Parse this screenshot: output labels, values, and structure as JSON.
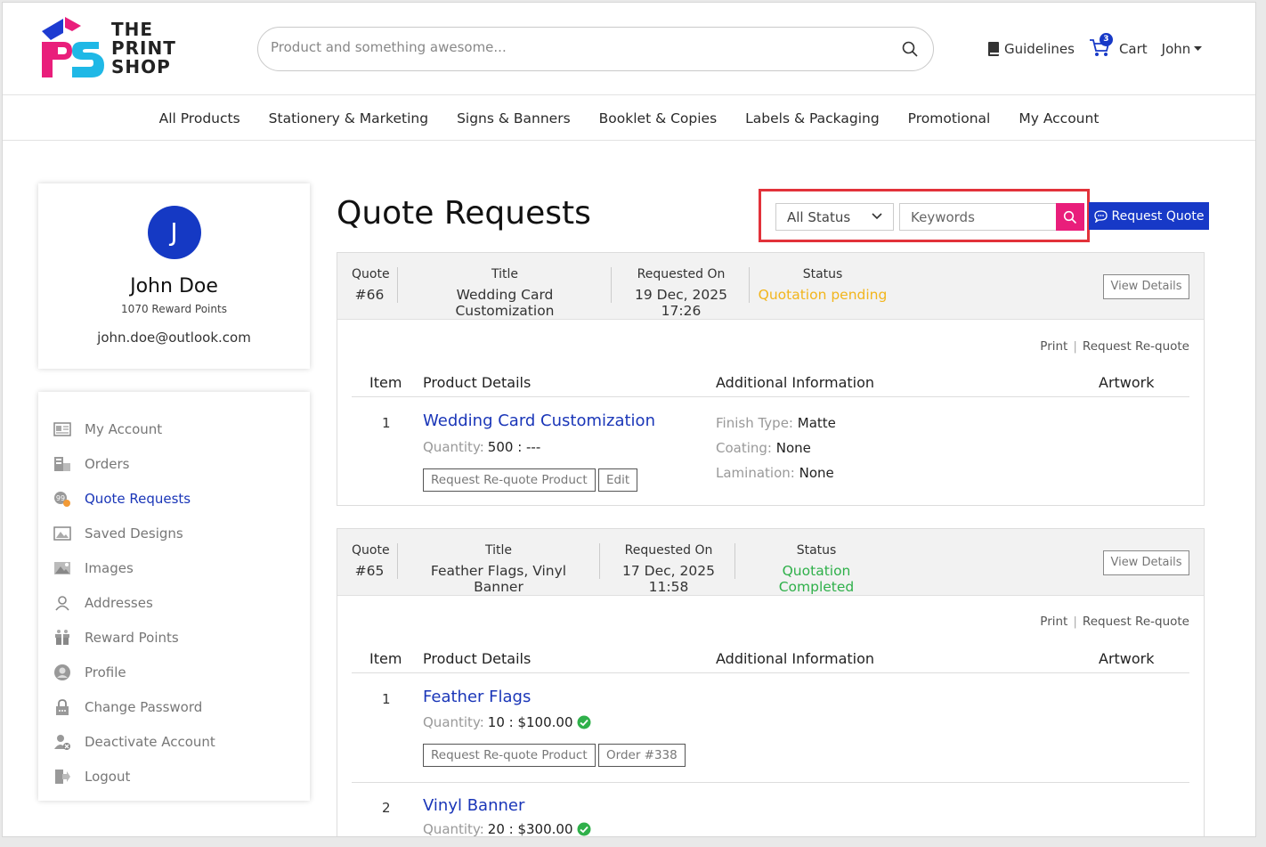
{
  "brand": {
    "line1": "THE",
    "line2": "PRINT",
    "line3": "SHOP"
  },
  "search": {
    "placeholder": "Product and something awesome..."
  },
  "header": {
    "guidelines": "Guidelines",
    "cart": "Cart",
    "cart_count": "3",
    "user": "John"
  },
  "nav": [
    "All Products",
    "Stationery & Marketing",
    "Signs & Banners",
    "Booklet & Copies",
    "Labels & Packaging",
    "Promotional",
    "My Account"
  ],
  "profile": {
    "initial": "J",
    "name": "John Doe",
    "points": "1070 Reward Points",
    "email": "john.doe@outlook.com"
  },
  "menu": [
    {
      "label": "My Account",
      "icon": "id-card-icon"
    },
    {
      "label": "Orders",
      "icon": "orders-icon"
    },
    {
      "label": "Quote Requests",
      "icon": "quote-icon"
    },
    {
      "label": "Saved Designs",
      "icon": "designs-icon"
    },
    {
      "label": "Images",
      "icon": "images-icon"
    },
    {
      "label": "Addresses",
      "icon": "address-icon"
    },
    {
      "label": "Reward Points",
      "icon": "reward-icon"
    },
    {
      "label": "Profile",
      "icon": "profile-icon"
    },
    {
      "label": "Change Password",
      "icon": "password-icon"
    },
    {
      "label": "Deactivate Account",
      "icon": "deactivate-icon"
    },
    {
      "label": "Logout",
      "icon": "logout-icon"
    }
  ],
  "page": {
    "title": "Quote Requests",
    "status_filter": "All Status",
    "keywords_placeholder": "Keywords",
    "request_quote": "Request Quote"
  },
  "labels": {
    "quote": "Quote",
    "title": "Title",
    "requested_on": "Requested On",
    "status": "Status",
    "view_details": "View Details",
    "print": "Print",
    "request_requote": "Request Re-quote",
    "item": "Item",
    "product_details": "Product Details",
    "additional_information": "Additional Information",
    "artwork": "Artwork",
    "quantity": "Quantity:",
    "requote_product": "Request Re-quote Product",
    "edit": "Edit"
  },
  "quotes": [
    {
      "number": "#66",
      "title": "Wedding Card Customization",
      "requested_on": "19 Dec, 2025 17:26",
      "status": "Quotation pending",
      "status_color": "#f2b51c",
      "items": [
        {
          "num": "1",
          "name": "Wedding Card Customization",
          "qty": "500 : ---",
          "action2": "Edit",
          "info": [
            {
              "k": "Finish Type:",
              "v": "Matte"
            },
            {
              "k": "Coating:",
              "v": "None"
            },
            {
              "k": "Lamination:",
              "v": "None"
            }
          ]
        }
      ]
    },
    {
      "number": "#65",
      "title": "Feather Flags, Vinyl Banner",
      "requested_on": "17 Dec, 2025 11:58",
      "status": "Quotation Completed",
      "status_color": "#2fb04a",
      "items": [
        {
          "num": "1",
          "name": "Feather Flags",
          "qty": "10 : $100.00",
          "action2": "Order #338"
        },
        {
          "num": "2",
          "name": "Vinyl Banner",
          "qty": "20 : $300.00"
        }
      ]
    }
  ]
}
